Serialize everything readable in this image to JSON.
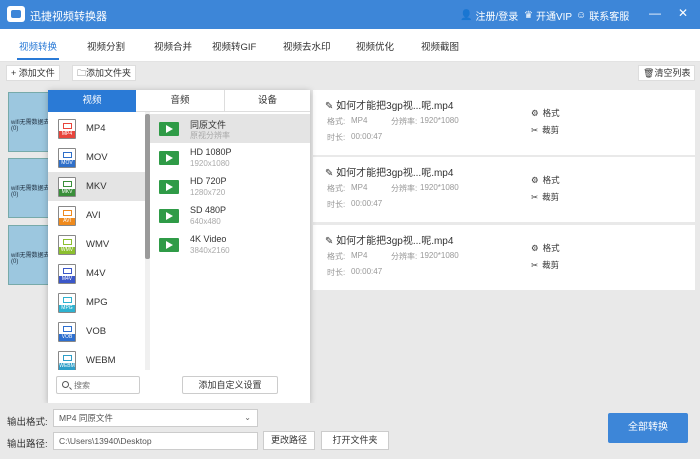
{
  "app": {
    "title": "迅捷视频转换器",
    "login": "注册/登录",
    "vip": "开通VIP",
    "support": "联系客服",
    "minimize": "—",
    "close": "✕"
  },
  "tabs": [
    "视频转换",
    "视频分割",
    "视频合并",
    "视频转GIF",
    "视频去水印",
    "视频优化",
    "视频截图"
  ],
  "toolbar": {
    "add_file": "添加文件",
    "add_folder": "添加文件夹",
    "clear_list": "清空列表"
  },
  "files": [
    {
      "name": "如何才能把3gp视...呢.mp4",
      "format_label": "格式:",
      "format": "MP4",
      "res_label": "分辨率:",
      "res": "1920*1080",
      "dur_label": "时长:",
      "duration": "00:00:47",
      "format_btn": "格式",
      "cut_btn": "裁剪",
      "thumb_text": "wifi无需数据去(0)"
    },
    {
      "name": "如何才能把3gp视...呢.mp4",
      "format_label": "格式:",
      "format": "MP4",
      "res_label": "分辨率:",
      "res": "1920*1080",
      "dur_label": "时长:",
      "duration": "00:00:47",
      "format_btn": "格式",
      "cut_btn": "裁剪",
      "thumb_text": "wifi无需数据去(0)"
    },
    {
      "name": "如何才能把3gp视...呢.mp4",
      "format_label": "格式:",
      "format": "MP4",
      "res_label": "分辨率:",
      "res": "1920*1080",
      "dur_label": "时长:",
      "duration": "00:00:47",
      "format_btn": "格式",
      "cut_btn": "裁剪",
      "thumb_text": "wifi无需数据去(0)"
    }
  ],
  "panel": {
    "tabs": [
      "视频",
      "音频",
      "设备"
    ],
    "formats": [
      {
        "name": "MP4",
        "color": "#e8453c"
      },
      {
        "name": "MOV",
        "color": "#2f6fc9"
      },
      {
        "name": "MKV",
        "color": "#3a8f3a"
      },
      {
        "name": "AVI",
        "color": "#ef8a1d"
      },
      {
        "name": "WMV",
        "color": "#8cbf2e"
      },
      {
        "name": "M4V",
        "color": "#3b57c9"
      },
      {
        "name": "MPG",
        "color": "#2eb2d0"
      },
      {
        "name": "VOB",
        "color": "#2d6fd0"
      },
      {
        "name": "WEBM",
        "color": "#2e9fc9"
      }
    ],
    "selected_format": "MKV",
    "qualities": [
      {
        "name": "同原文件",
        "res": "原视分辨率"
      },
      {
        "name": "HD 1080P",
        "res": "1920x1080"
      },
      {
        "name": "HD 720P",
        "res": "1280x720"
      },
      {
        "name": "SD 480P",
        "res": "640x480"
      },
      {
        "name": "4K Video",
        "res": "3840x2160"
      }
    ],
    "search_placeholder": "搜索",
    "custom_btn": "添加自定义设置"
  },
  "bottom": {
    "output_format_label": "输出格式:",
    "output_format_value": "MP4  同原文件",
    "output_path_label": "输出路径:",
    "output_path_value": "C:\\Users\\13940\\Desktop",
    "change_path": "更改路径",
    "open_folder": "打开文件夹",
    "convert_all": "全部转换"
  },
  "colors": {
    "accent": "#3d86d8",
    "tab_active": "#2a7ad6"
  }
}
